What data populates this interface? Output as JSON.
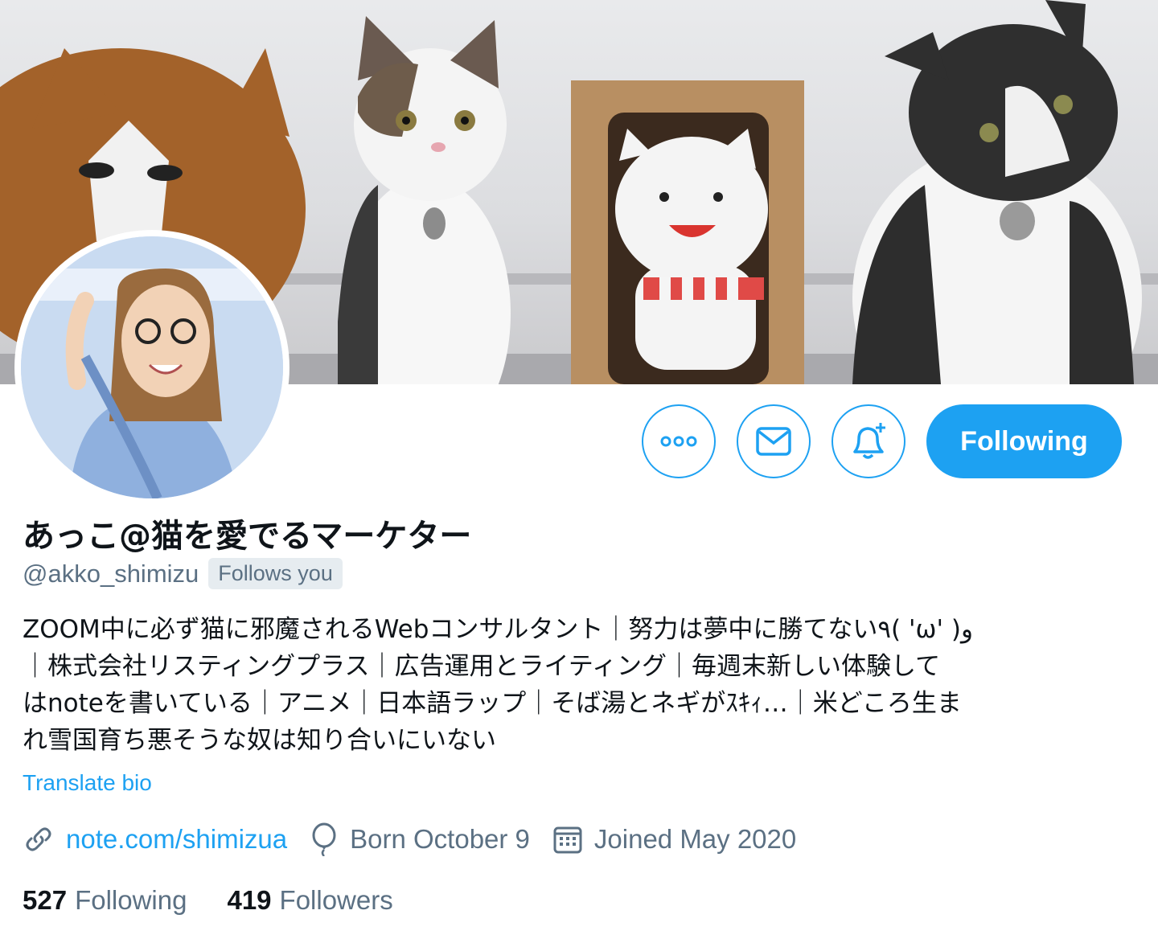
{
  "profile": {
    "display_name": "あっこ@猫を愛でるマーケター",
    "handle": "@akko_shimizu",
    "follows_you": "Follows you",
    "bio_lines": [
      "ZOOM中に必ず猫に邪魔されるWebコンサルタント｜努力は夢中に勝てない٩( 'ω' )و",
      "｜株式会社リスティングプラス｜広告運用とライティング｜毎週末新しい体験して",
      "はnoteを書いている｜アニメ｜日本語ラップ｜そば湯とネギがｽｷｨ…｜米どころ生ま",
      "れ雪国育ち悪そうな奴は知り合いにいない"
    ],
    "translate_label": "Translate bio",
    "website": "note.com/shimizua",
    "birthday": "Born October 9",
    "joined": "Joined May 2020",
    "following_count": "527",
    "following_label": "Following",
    "followers_count": "419",
    "followers_label": "Followers"
  },
  "actions": {
    "more_icon": "more-icon",
    "message_icon": "mail-icon",
    "notify_icon": "bell-plus-icon",
    "following_button_label": "Following"
  },
  "colors": {
    "accent": "#1da1f2",
    "secondary_text": "#5b7083",
    "primary_text": "#0f1419",
    "badge_bg": "#e6ecf0"
  }
}
